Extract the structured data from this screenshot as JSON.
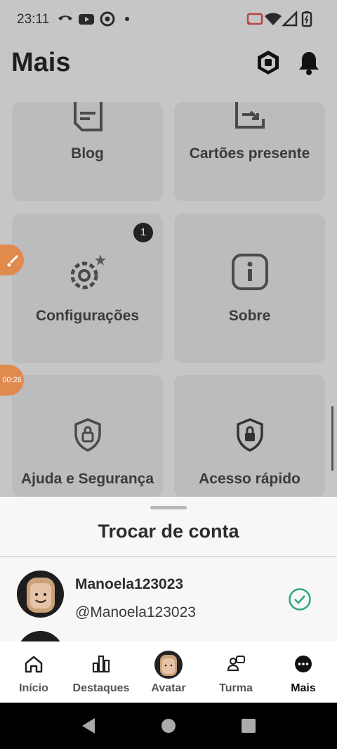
{
  "status_bar": {
    "time": "23:11"
  },
  "header": {
    "title": "Mais"
  },
  "tiles": [
    {
      "label": "Blog"
    },
    {
      "label": "Cartões presente"
    },
    {
      "label": "Configurações",
      "badge": "1"
    },
    {
      "label": "Sobre"
    },
    {
      "label": "Ajuda e Segurança"
    },
    {
      "label": "Acesso rápido"
    }
  ],
  "floating": {
    "timer": "00:26"
  },
  "sheet": {
    "title": "Trocar de conta",
    "accounts": [
      {
        "name": "Manoela123023",
        "handle": "@Manoela123023",
        "selected": true
      }
    ]
  },
  "bottom_nav": [
    {
      "label": "Início",
      "icon": "home-icon"
    },
    {
      "label": "Destaques",
      "icon": "chart-icon"
    },
    {
      "label": "Avatar",
      "icon": "avatar-icon"
    },
    {
      "label": "Turma",
      "icon": "people-icon"
    },
    {
      "label": "Mais",
      "icon": "more-icon",
      "active": true
    }
  ],
  "colors": {
    "accent_check": "#2ea77a",
    "float": "#e08a4e",
    "overlay": "#c6c6c6"
  }
}
